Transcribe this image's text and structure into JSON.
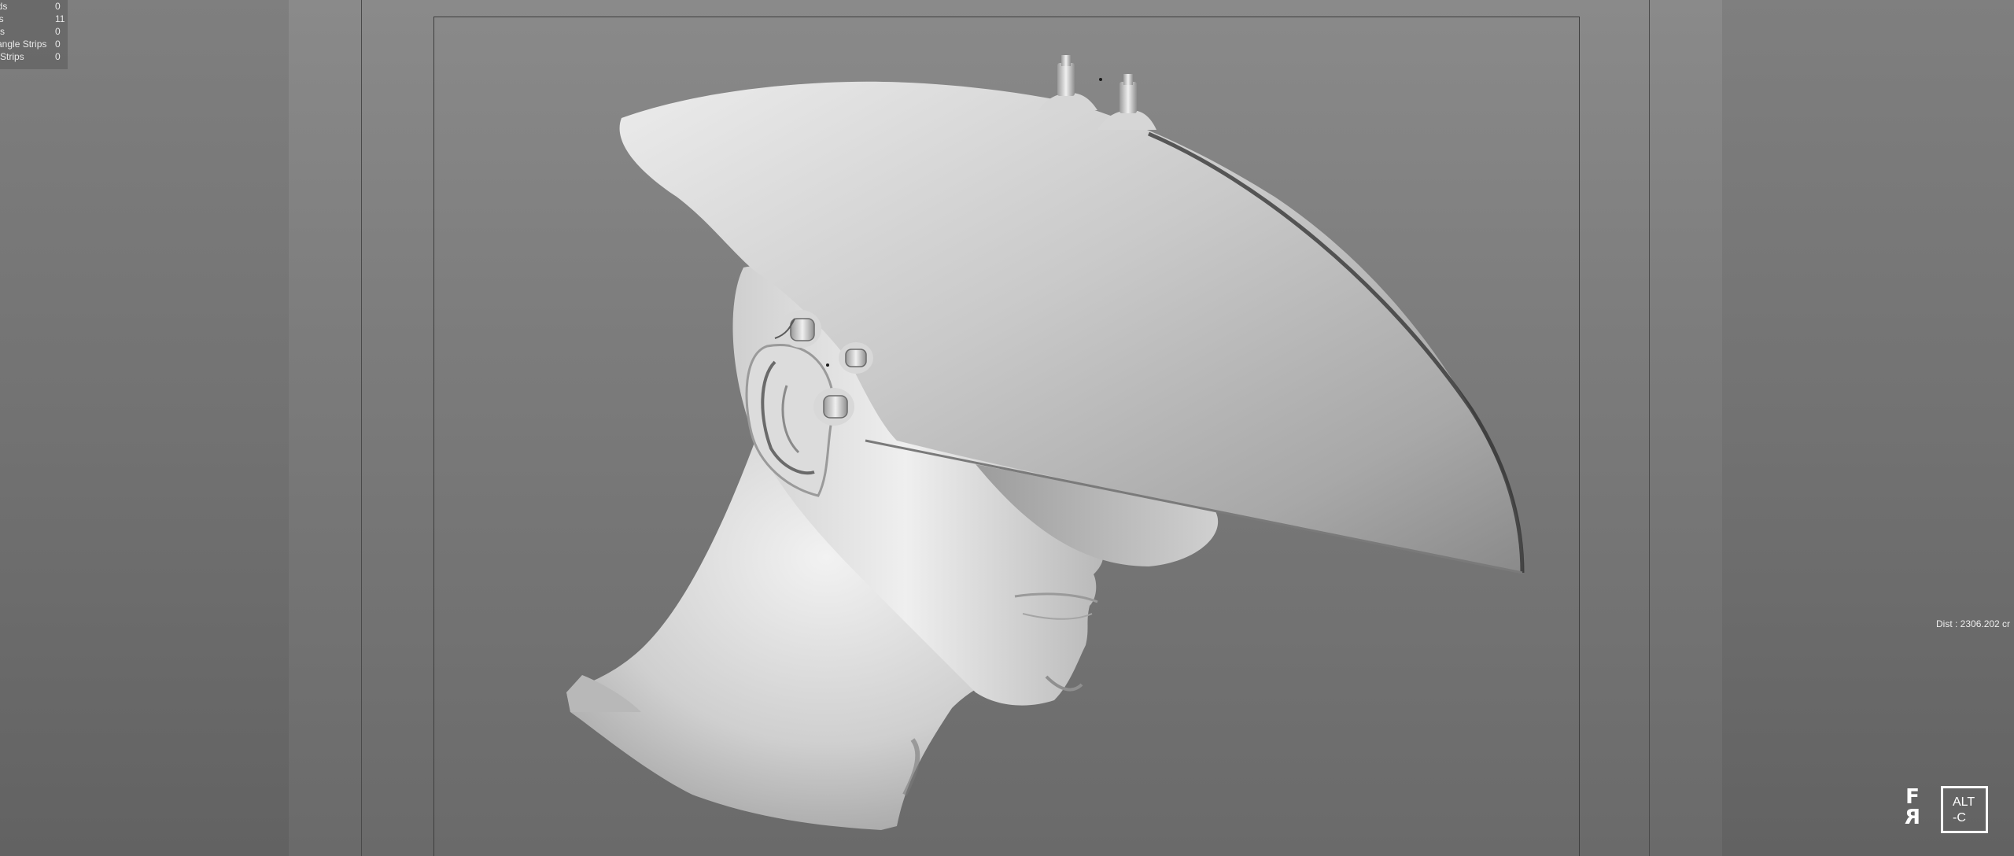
{
  "hud": {
    "rows": [
      {
        "label": "ads",
        "value": "0"
      },
      {
        "label": "es",
        "value": "11"
      },
      {
        "label": "nts",
        "value": "0"
      },
      {
        "label": "angle Strips",
        "value": "0"
      },
      {
        "label": "e Strips",
        "value": "0"
      }
    ]
  },
  "dist_label": "Dist : 2306.202 cr",
  "logos": {
    "fr_top": "F",
    "fr_bottom": "R",
    "alt_line1": "ALT",
    "alt_line2": "-C"
  },
  "colors": {
    "viewport_top": "#8a8a8a",
    "viewport_bottom": "#6a6a6a",
    "hud_bg": "#5a5a5a",
    "logo": "#ffffff"
  },
  "icons": [
    "3d-model-head-icon",
    "fr-logo-icon",
    "alt-c-logo-icon"
  ]
}
